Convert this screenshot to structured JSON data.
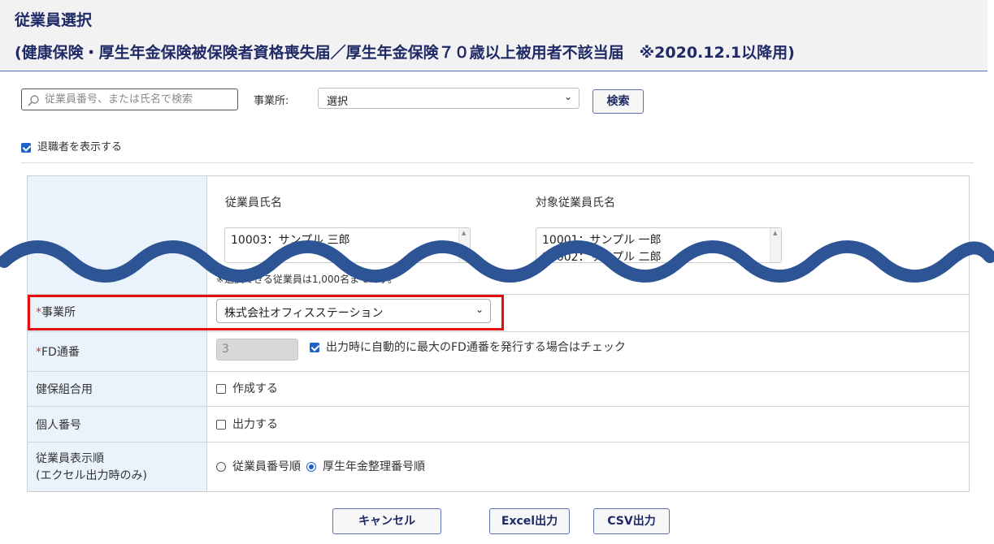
{
  "header": {
    "title": "従業員選択",
    "subtitle": "(健康保険・厚生年金保険被保険者資格喪失届／厚生年金保険７０歳以上被用者不該当届　※2020.12.1以降用)"
  },
  "search": {
    "placeholder": "従業員番号、または氏名で検索",
    "office_label": "事業所:",
    "office_value": "選択",
    "search_button": "検索"
  },
  "filters": {
    "show_retired_label": "退職者を表示する",
    "show_retired_checked": true
  },
  "employees": {
    "left_header": "従業員氏名",
    "right_header": "対象従業員氏名",
    "left_items": [
      "10003：サンプル 三郎"
    ],
    "right_items": [
      "10001：サンプル 一郎",
      "10002：サンプル 二郎"
    ],
    "note": "※選択できる従業員は1,000名までです。"
  },
  "form": {
    "office": {
      "required_mark": "*",
      "label": "事業所",
      "value": "株式会社オフィスステーション"
    },
    "fd": {
      "required_mark": "*",
      "label": "FD通番",
      "value": "3",
      "auto_label": "出力時に自動的に最大のFD通番を発行する場合はチェック",
      "auto_checked": true
    },
    "kenpo": {
      "label": "健保組合用",
      "option": "作成する",
      "checked": false
    },
    "mynumber": {
      "label": "個人番号",
      "option": "出力する",
      "checked": false
    },
    "order": {
      "label_line1": "従業員表示順",
      "label_line2": "(エクセル出力時のみ)",
      "option1": "従業員番号順",
      "option2": "厚生年金整理番号順",
      "selected": "option2"
    }
  },
  "footer": {
    "cancel": "キャンセル",
    "excel": "Excel出力",
    "csv": "CSV出力"
  },
  "colors": {
    "title": "#1f2a66",
    "accent": "#1e64c8",
    "header_cell_bg": "#eaf3fb",
    "wave": "#2d5595",
    "highlight": "#e01010",
    "required": "#d9322f"
  }
}
